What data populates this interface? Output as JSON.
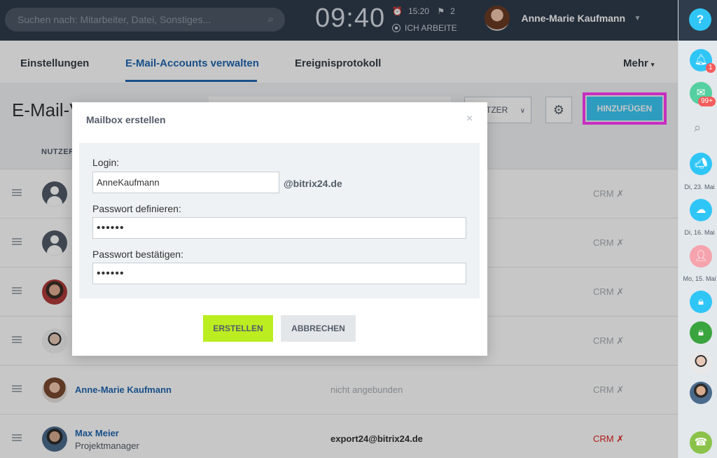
{
  "header": {
    "search_placeholder": "Suchen nach: Mitarbeiter, Datei, Sonstiges...",
    "clock": "09:40",
    "alarm_time": "15:20",
    "flag_count": "2",
    "work_status": "ICH ARBEITE",
    "user_name": "Anne-Marie Kaufmann",
    "icons": {
      "search": "magnifier",
      "alarm": "bell",
      "flag": "flag",
      "caret": "chevron-down"
    }
  },
  "right_panel": {
    "help": "?",
    "notifications_badge": "1",
    "messages_badge": "99+",
    "dates": [
      "Di, 23. Mai",
      "Di, 16. Mai",
      "Mo, 15. Mai"
    ]
  },
  "tabs": [
    {
      "label": "Einstellungen",
      "active": false
    },
    {
      "label": "E-Mail-Accounts verwalten",
      "active": true
    },
    {
      "label": "Ereignisprotokoll",
      "active": false
    },
    {
      "label": "Mehr",
      "active": false
    }
  ],
  "toolbar": {
    "title": "E-Mail-V",
    "role_select": "TZER",
    "add_button": "HINZUFÜGEN"
  },
  "table": {
    "column_user": "NUTZER",
    "rows": [
      {
        "name": "",
        "role": "",
        "mail": "",
        "crm": "CRM ✗"
      },
      {
        "name": "",
        "role": "",
        "mail": "",
        "crm": "CRM ✗"
      },
      {
        "name": "",
        "role": "",
        "mail": "",
        "crm": "CRM ✗"
      },
      {
        "name": "",
        "role": "",
        "mail": "",
        "crm": "CRM ✗"
      },
      {
        "name": "Anne-Marie Kaufmann",
        "role": "",
        "mail": "nicht angebunden",
        "crm": "CRM ✗"
      },
      {
        "name": "Max Meier",
        "role": "Projektmanager",
        "mail": "export24@bitrix24.de",
        "crm": "CRM ✗"
      }
    ]
  },
  "modal": {
    "title": "Mailbox erstellen",
    "close": "×",
    "login_label": "Login:",
    "login_value": "AnneKaufmann",
    "domain": "@bitrix24.de",
    "password_label": "Passwort definieren:",
    "password_value": "••••••",
    "confirm_label": "Passwort bestätigen:",
    "confirm_value": "••••••",
    "create_button": "ERSTELLEN",
    "cancel_button": "ABBRECHEN"
  },
  "colors": {
    "header_bg": "#2f3c4b",
    "link_blue": "#2067b0",
    "add_button": "#3bc8f5",
    "highlight_frame": "#ff3bf5",
    "create_button": "#bbed21",
    "crm_active": "#e12020"
  }
}
